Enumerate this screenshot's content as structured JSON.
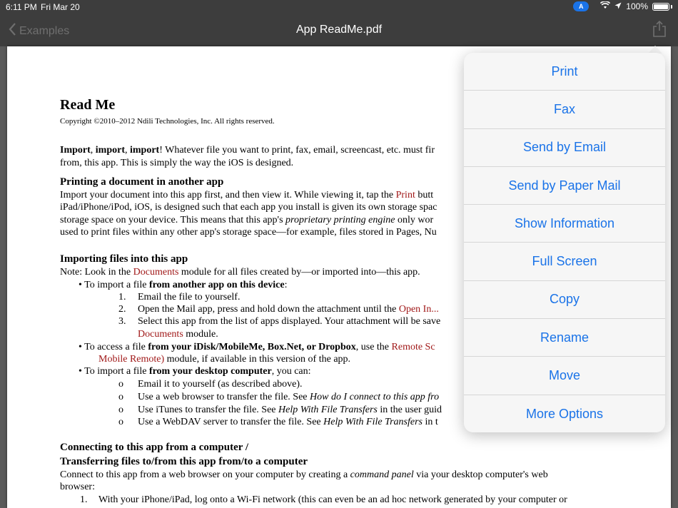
{
  "status": {
    "time": "6:11 PM",
    "date": "Fri Mar 20",
    "location_badge": "A",
    "battery": "100%"
  },
  "nav": {
    "back_label": "Examples",
    "title": "App ReadMe.pdf"
  },
  "document": {
    "title": "Read Me",
    "copyright": "Copyright ©2010–2012 Ndili Technologies, Inc. All rights reserved.",
    "intro_1a": "Import",
    "intro_1b": ", ",
    "intro_1c": "import",
    "intro_1d": ", ",
    "intro_1e": "import",
    "intro_1f": "! Whatever file you want to print, fax, email, screencast, etc. must fir",
    "intro_2": "from, this app. This is simply the way the iOS is designed.",
    "s1_heading": "Printing a document in another app",
    "s1_l1a": "Import your document into this app first, and then view it. While viewing it, tap the ",
    "s1_l1b": "Print",
    "s1_l1c": " butt",
    "s1_l2": "iPad/iPhone/iPod, iOS, is designed such that each app you install is given its own storage spac",
    "s1_l3a": "storage space on your device. This means that this app's ",
    "s1_l3b": "proprietary printing engine",
    "s1_l3c": " only wor",
    "s1_l4": "used to print files within any other app's storage space—for example, files stored in Pages, Nu",
    "s2_heading": "Importing files into this app",
    "s2_note_a": "Note: Look in the ",
    "s2_note_b": "Documents",
    "s2_note_c": " module for all files created by—or imported into—this app.",
    "b1a": "• To import a file ",
    "b1b": "from another app on this device",
    "b1c": ":",
    "n1_num": "1.",
    "n1": "Email the file to yourself.",
    "n2_num": "2.",
    "n2a": "Open the Mail app, press and hold down the attachment until the ",
    "n2b": "Open In...",
    "n3_num": "3.",
    "n3": "Select this app from the list of apps displayed. Your attachment will be save",
    "n3b_a": "Documents",
    "n3b_b": " module.",
    "b2a": "• To access a file ",
    "b2b": "from your iDisk/MobileMe, Box.Net, or Dropbox",
    "b2c": ", use the ",
    "b2d": "Remote Sc",
    "b2_l2a": "Mobile Remote)",
    "b2_l2b": " module, if available in this version of the app.",
    "b3a": "• To import a file ",
    "b3b": "from your desktop computer",
    "b3c": ", you can:",
    "o_bullet": "o",
    "o1": "Email it to yourself (as described above).",
    "o2a": "Use a web browser to transfer the file. See ",
    "o2b": "How do I connect to this app fro",
    "o3a": "Use iTunes to transfer the file. See ",
    "o3b": "Help With File Transfers",
    "o3c": " in the user guid",
    "o4a": "Use a WebDAV server to transfer the file. See ",
    "o4b": "Help With File Transfers",
    "o4c": " in t",
    "s3_heading_1": "Connecting to this app from a computer /",
    "s3_heading_2": "Transferring files to/from this app from/to a computer",
    "s3_l1a": "Connect to this app from a web browser on your computer by creating a ",
    "s3_l1b": "command panel",
    "s3_l1c": " via your desktop computer's web",
    "s3_l2": "browser:",
    "s3_n1_num": "1.",
    "s3_n1": "With your iPhone/iPad, log onto a Wi-Fi network (this can even be an ad hoc network generated by your computer or"
  },
  "menu": [
    "Print",
    "Fax",
    "Send by Email",
    "Send by Paper Mail",
    "Show Information",
    "Full Screen",
    "Copy",
    "Rename",
    "Move",
    "More Options"
  ],
  "icons": {
    "back": "chevron-left-icon",
    "share": "share-icon",
    "wifi": "wifi-icon",
    "location": "location-arrow-icon",
    "battery": "battery-icon"
  },
  "colors": {
    "accent": "#1a73e8",
    "link_red": "#a01818",
    "bar": "#3d3d3d"
  }
}
